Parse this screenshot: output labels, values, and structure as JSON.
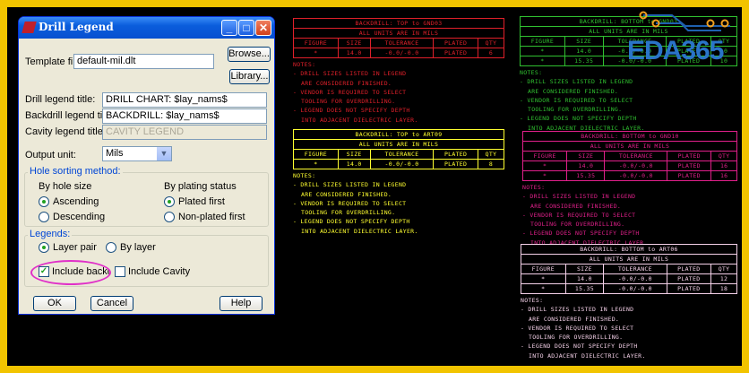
{
  "dialog": {
    "title": "Drill Legend",
    "template_label": "Template file:",
    "template_value": "default-mil.dlt",
    "browse": "Browse...",
    "library": "Library...",
    "drill_label": "Drill legend title:",
    "drill_value": "DRILL CHART: $lay_nams$",
    "backdrill_label": "Backdrill legend title:",
    "backdrill_value": "BACKDRILL: $lay_nams$",
    "cavity_label": "Cavity legend title:",
    "cavity_value": "CAVITY LEGEND",
    "unit_label": "Output unit:",
    "unit_value": "Mils",
    "sorting_group": "Hole sorting method:",
    "by_size": "By hole size",
    "ascending": "Ascending",
    "descending": "Descending",
    "by_plating": "By plating status",
    "plated_first": "Plated first",
    "nonplated_first": "Non-plated first",
    "legends_group": "Legends:",
    "layer_pair": "Layer pair",
    "by_layer": "By layer",
    "include_backdrill": "Include backdrill",
    "include_cavity": "Include Cavity",
    "ok": "OK",
    "cancel": "Cancel",
    "help": "Help"
  },
  "logo_text": "EDA365",
  "legend_headers": [
    "FIGURE",
    "SIZE",
    "TOLERANCE",
    "PLATED",
    "QTY"
  ],
  "legends": [
    {
      "title": "BACKDRILL: TOP to GND03",
      "units": "ALL UNITS ARE IN MILS",
      "color": "#e0202a",
      "rows": [
        [
          "*",
          "14.0",
          "-0.0/-0.0",
          "PLATED",
          "6"
        ]
      ]
    },
    {
      "title": "BACKDRILL: TOP to ART09",
      "units": "ALL UNITS ARE IN MILS",
      "color": "#ffff30",
      "rows": [
        [
          "*",
          "14.0",
          "-0.0/-0.0",
          "PLATED",
          "8"
        ]
      ]
    },
    {
      "title": "BACKDRILL: BOTTOM to GND03",
      "units": "ALL UNITS ARE IN MILS",
      "color": "#30c030",
      "rows": [
        [
          "*",
          "14.0",
          "-0.0/-0.0",
          "PLATED",
          "10"
        ],
        [
          "*",
          "15.35",
          "-0.0/-0.0",
          "PLATED",
          "10"
        ]
      ]
    },
    {
      "title": "BACKDRILL: BOTTOM to GND10",
      "units": "ALL UNITS ARE IN MILS",
      "color": "#e0208a",
      "rows": [
        [
          "*",
          "14.0",
          "-0.0/-0.0",
          "PLATED",
          "16"
        ],
        [
          "*",
          "15.35",
          "-0.0/-0.0",
          "PLATED",
          "16"
        ]
      ]
    },
    {
      "title": "BACKDRILL: BOTTOM to ART06",
      "units": "ALL UNITS ARE IN MILS",
      "color": "#f4d0e8",
      "rows": [
        [
          "*",
          "14.0",
          "-0.0/-0.0",
          "PLATED",
          "12"
        ],
        [
          "*",
          "15.35",
          "-0.0/-0.0",
          "PLATED",
          "18"
        ]
      ]
    }
  ],
  "notes": [
    "NOTES:",
    "- DRILL SIZES LISTED IN LEGEND",
    "ARE CONSIDERED FINISHED.",
    "- VENDOR IS REQUIRED TO SELECT",
    "TOOLING FOR OVERDRILLING.",
    "- LEGEND DOES NOT SPECIFY DEPTH",
    "INTO ADJACENT DIELECTRIC LAYER."
  ]
}
